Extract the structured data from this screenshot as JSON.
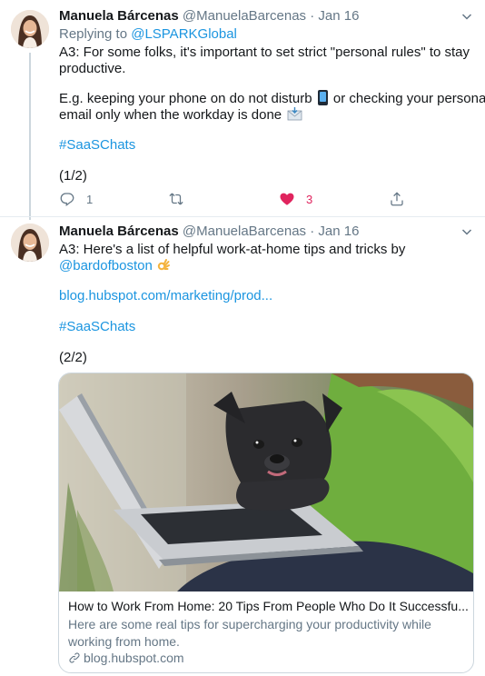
{
  "tweets": [
    {
      "author_name": "Manuela Bárcenas",
      "handle": "@ManuelaBarcenas",
      "separator": "·",
      "date": "Jan 16",
      "replying_prefix": "Replying to",
      "replying_to": "@LSPARKGlobal",
      "text_line1": "A3: For some folks, it's important to set strict \"personal rules\" to stay",
      "text_line2": "productive.",
      "text_line3": "E.g. keeping your phone on do not disturb",
      "text_line3b": "or checking your personal",
      "text_line4": "email only when the workday is done",
      "hashtag": "#SaaSChats",
      "counter": "(1/2)",
      "reply_count": "1",
      "retweet_count": "",
      "like_count": "3",
      "liked": true
    },
    {
      "author_name": "Manuela Bárcenas",
      "handle": "@ManuelaBarcenas",
      "separator": "·",
      "date": "Jan 16",
      "text_line1": "A3: Here's a list of helpful work-at-home tips and tricks by",
      "mention": "@bardofboston",
      "url": "blog.hubspot.com/marketing/prod...",
      "hashtag": "#SaaSChats",
      "counter": "(2/2)",
      "card": {
        "title": "How to Work From Home: 20 Tips From People Who Do It Successfu...",
        "description": "Here are some real tips for supercharging your productivity while working from home.",
        "domain": "blog.hubspot.com"
      }
    }
  ],
  "icons": {
    "reply": "reply-icon",
    "retweet": "retweet-icon",
    "like": "heart-icon",
    "share": "share-icon",
    "menu": "chevron-down-icon",
    "link": "link-icon"
  },
  "colors": {
    "link": "#1b95e0",
    "like": "#e0245e",
    "secondary": "#657786",
    "border": "#ccd6dd"
  }
}
